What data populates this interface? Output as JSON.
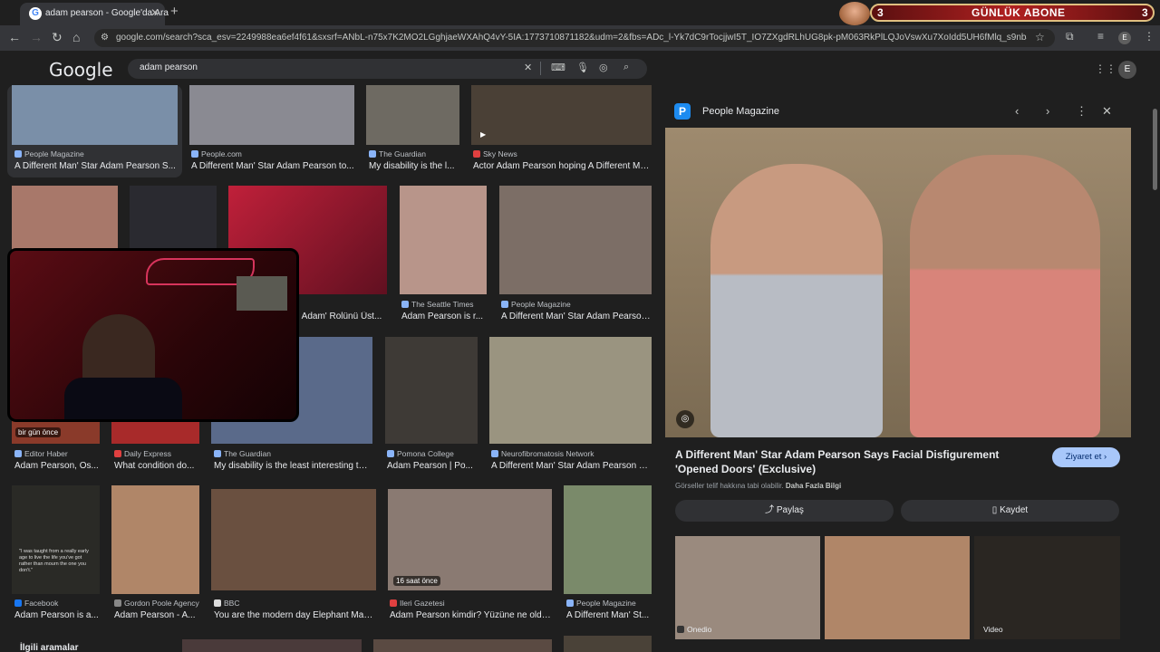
{
  "browser": {
    "tab_title": "adam pearson - Google'da Ara",
    "url": "google.com/search?sca_esv=2249988ea6ef4f61&sxsrf=ANbL-n75x7K2MO2LGghjaeWXAhQ4vY-5IA:1773710871182&udm=2&fbs=ADc_l-Yk7dC9rTocjjwI5T_IO7ZXgdRLhUG8pk-pM063RkPlLQJoVswXu7XoIdd5UH6fMlq_s9nb4YoXhm4SVUwlynG...",
    "profile_initial": "E"
  },
  "overlay": {
    "banner_left_num": "3",
    "banner_text": "GÜNLÜK ABONE",
    "banner_right_num": "3"
  },
  "google": {
    "logo": "Google",
    "query": "adam pearson"
  },
  "results": [
    {
      "source": "People Magazine",
      "title": "A Different Man' Star Adam Pearson S...",
      "color": "#7a8fa8"
    },
    {
      "source": "People.com",
      "title": "A Different Man' Star Adam Pearson to...",
      "color": "#8a8a92"
    },
    {
      "source": "The Guardian",
      "title": "My disability is the l...",
      "color": "#6e6a62"
    },
    {
      "source": "Sky News",
      "title": "Actor Adam Pearson hoping A Different Ma...",
      "color": "#4a4036"
    },
    {
      "source": "The Seattle Times",
      "title": "Adam Pearson is r...",
      "color": "#b8958a"
    },
    {
      "source": "People Magazine",
      "title": "A Different Man' Star Adam Pearson...",
      "color": "#7c6e66"
    },
    {
      "source": "Editor Haber",
      "title": "Adam Pearson, Os...",
      "color": "#8a3a2a"
    },
    {
      "source": "Daily Express",
      "title": "What condition do...",
      "color": "#a82a2a"
    },
    {
      "source": "The Guardian",
      "title": "My disability is the least interesting thi...",
      "color": "#5a6a8a"
    },
    {
      "source": "Pomona College",
      "title": "Adam Pearson | Po...",
      "color": "#3e3a36"
    },
    {
      "source": "Neurofibromatosis Network",
      "title": "A Different Man' Star Adam Pearson S...",
      "color": "#9a9480"
    },
    {
      "source": "Facebook",
      "title": "Adam Pearson is a...",
      "color": "#2a2a26"
    },
    {
      "source": "Gordon Poole Agency",
      "title": "Adam Pearson - A...",
      "color": "#b08668"
    },
    {
      "source": "BBC",
      "title": "You are the modern day Elephant Man'...",
      "color": "#6a5040"
    },
    {
      "source": "Ileri Gazetesi",
      "title": "Adam Pearson kimdir? Yüzüne ne oldu...",
      "color": "#8a7a72"
    },
    {
      "source": "People Magazine",
      "title": "A Different Man' St...",
      "color": "#7a8a6a"
    }
  ],
  "extra_thumbs": {
    "partial_title": "il Adam' Rolünü Üst...",
    "badge_ago_1": "bir gün önce",
    "badge_ago_2": "16 saat önce",
    "quote": "\"I was taught from a really early age to live the life you've got rather than mourn the one you don't.\"",
    "related_searches": "İlgili aramalar"
  },
  "panel": {
    "source": "People Magazine",
    "title": "A Different Man' Star Adam Pearson Says Facial Disfigurement 'Opened Doors' (Exclusive)",
    "visit": "Ziyaret et",
    "copyright": "Görseller telif hakkına tabi olabilir.",
    "more_info": "Daha Fazla Bilgi",
    "share": "Paylaş",
    "save": "Kaydet",
    "related_source": "Onedio",
    "video_label": "Video"
  }
}
